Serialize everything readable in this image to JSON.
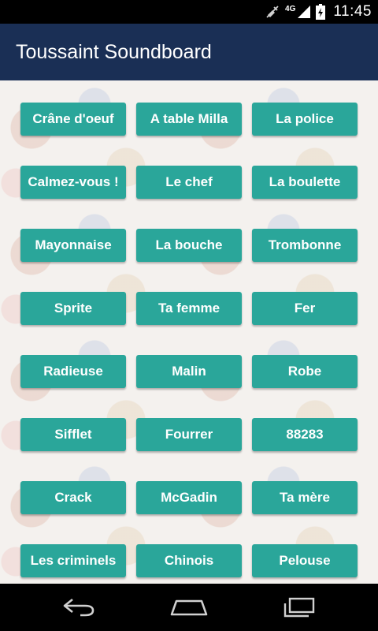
{
  "status_bar": {
    "network": "4G",
    "time": "11:45",
    "icons": [
      "muted-icon",
      "signal-icon",
      "battery-icon"
    ]
  },
  "app_bar": {
    "title": "Toussaint Soundboard"
  },
  "buttons": [
    "Crâne d'oeuf",
    "A table Milla",
    "La police",
    "Calmez-vous !",
    "Le chef",
    "La boulette",
    "Mayonnaise",
    "La bouche",
    "Trombonne",
    "Sprite",
    "Ta femme",
    "Fer",
    "Radieuse",
    "Malin",
    "Robe",
    "Sifflet",
    "Fourrer",
    "88283",
    "Crack",
    "McGadin",
    "Ta mère",
    "Les criminels",
    "Chinois",
    "Pelouse"
  ],
  "nav_bar": {
    "icons": [
      "back-icon",
      "home-icon",
      "recents-icon"
    ]
  },
  "colors": {
    "app_bar": "#1a2f55",
    "button": "#2aa69a",
    "button_text": "#ffffff",
    "status_bar": "#000000"
  }
}
